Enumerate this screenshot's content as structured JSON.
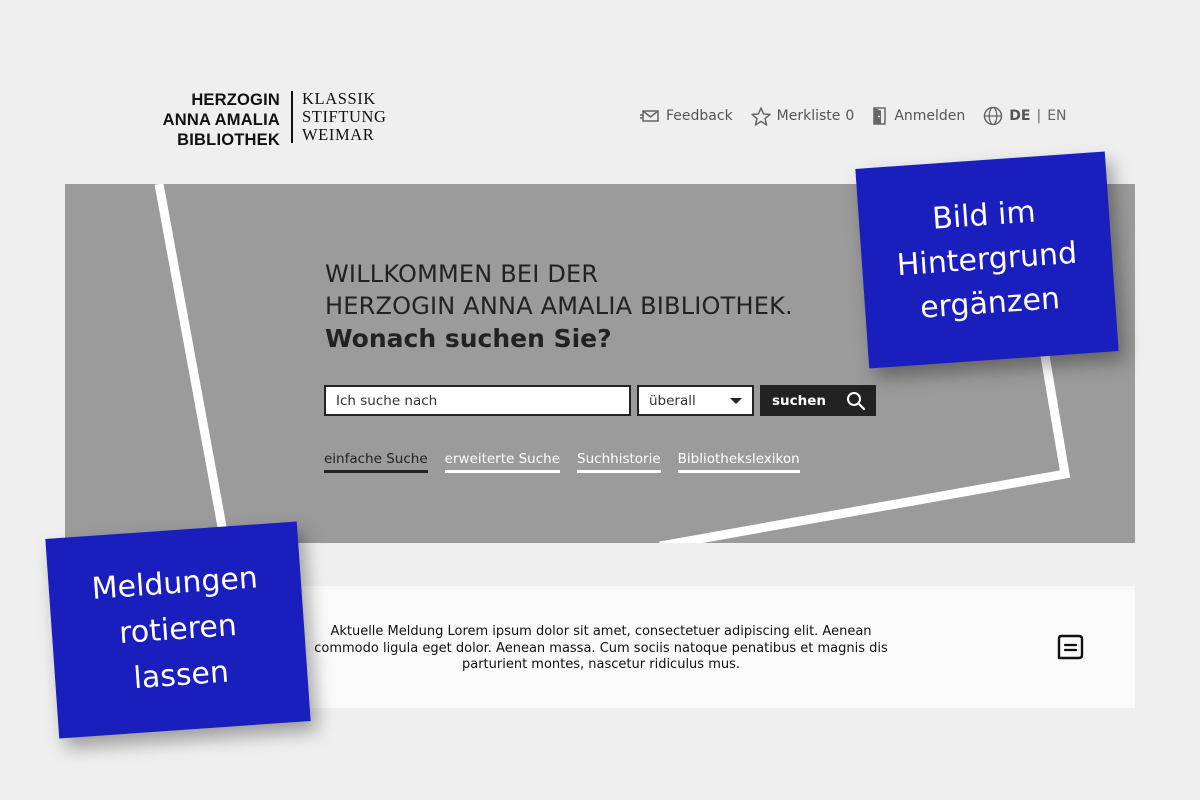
{
  "logo": {
    "left_lines": [
      "HERZOGIN",
      "ANNA AMALIA",
      "BIBLIOTHEK"
    ],
    "right_lines": [
      "KLASSIK",
      "STIFTUNG",
      "WEIMAR"
    ]
  },
  "topnav": {
    "feedback_label": "Feedback",
    "merkliste_label": "Merkliste",
    "merkliste_count": "0",
    "login_label": "Anmelden",
    "lang_de": "DE",
    "lang_sep": "|",
    "lang_en": "EN",
    "icons": [
      "feedback-mail-icon",
      "star-icon",
      "door-login-icon",
      "globe-icon"
    ]
  },
  "hero": {
    "line1": "WILLKOMMEN BEI DER",
    "line2": "HERZOGIN ANNA AMALIA BIBLIOTHEK.",
    "line3": "Wonach suchen Sie?",
    "background": "#9b9b9b"
  },
  "search": {
    "placeholder": "Ich suche nach",
    "scope_value": "überall",
    "button_label": "suchen",
    "tabs": [
      {
        "label": "einfache Suche",
        "active": true
      },
      {
        "label": "erweiterte Suche",
        "active": false
      },
      {
        "label": "Suchhistorie",
        "active": false
      },
      {
        "label": "Bibliothekslexikon",
        "active": false
      }
    ]
  },
  "news": {
    "text": "Aktuelle Meldung Lorem ipsum dolor sit amet, consectetuer adipiscing elit. Aenean commodo ligula eget dolor. Aenean massa. Cum sociis natoque penatibus et magnis dis parturient montes, nascetur ridiculus mus."
  },
  "notes": {
    "note1_lines": [
      "Bild im",
      "Hintergrund",
      "ergänzen"
    ],
    "note2_lines": [
      "Meldungen",
      "rotieren",
      "lassen"
    ],
    "color": "#1a1ebd"
  }
}
